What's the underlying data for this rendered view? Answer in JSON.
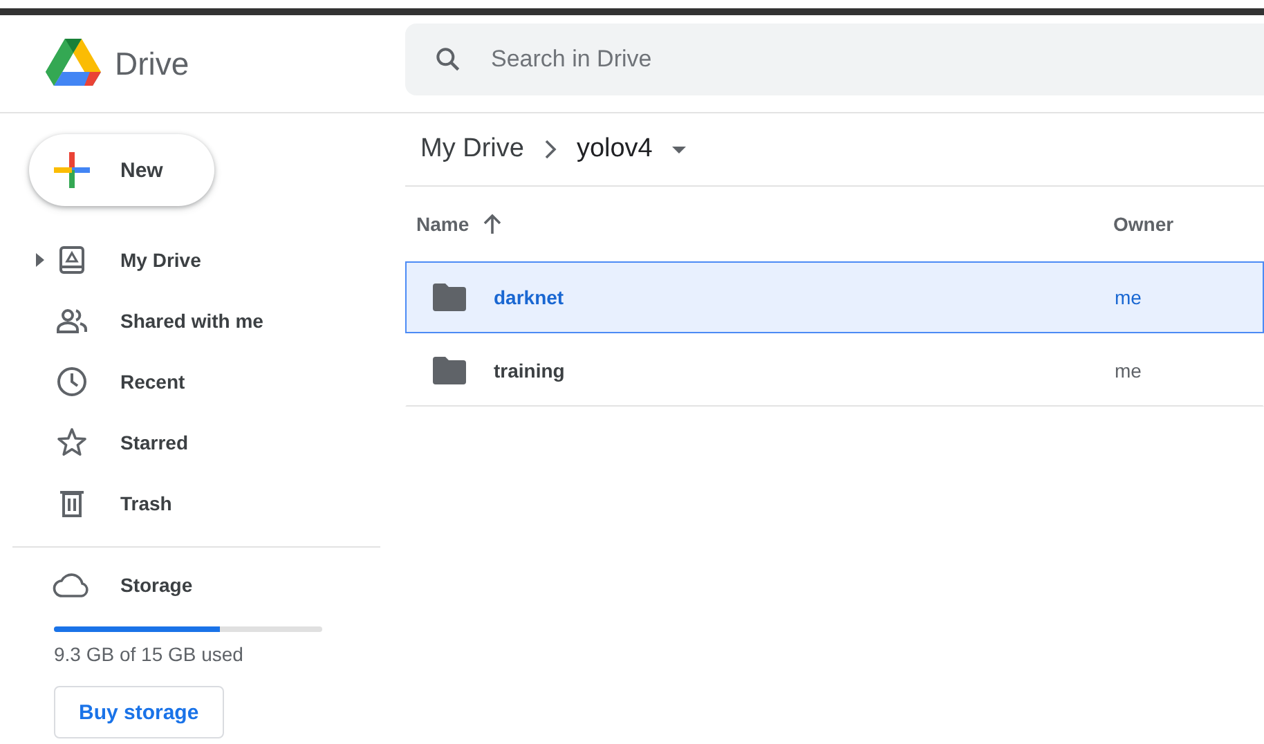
{
  "app": {
    "name": "Drive"
  },
  "search": {
    "placeholder": "Search in Drive"
  },
  "new_button": {
    "label": "New"
  },
  "sidebar": {
    "items": [
      {
        "kind": "drive",
        "label": "My Drive",
        "has_children": true
      },
      {
        "kind": "shared",
        "label": "Shared with me",
        "has_children": false
      },
      {
        "kind": "recent",
        "label": "Recent",
        "has_children": false
      },
      {
        "kind": "starred",
        "label": "Starred",
        "has_children": false
      },
      {
        "kind": "trash",
        "label": "Trash",
        "has_children": false
      }
    ]
  },
  "storage": {
    "label": "Storage",
    "level": 0.62,
    "usage": "9.3 GB of 15 GB used",
    "button": "Buy storage"
  },
  "breadcrumb": {
    "items": [
      "My Drive",
      "yolov4"
    ]
  },
  "table": {
    "columns": [
      {
        "label": "Name",
        "sorted": true
      },
      {
        "label": "Owner",
        "sorted": false
      }
    ],
    "rows": [
      {
        "name": "darknet",
        "owner": "me",
        "selected": true
      },
      {
        "name": "training",
        "owner": "me",
        "selected": false
      }
    ]
  }
}
